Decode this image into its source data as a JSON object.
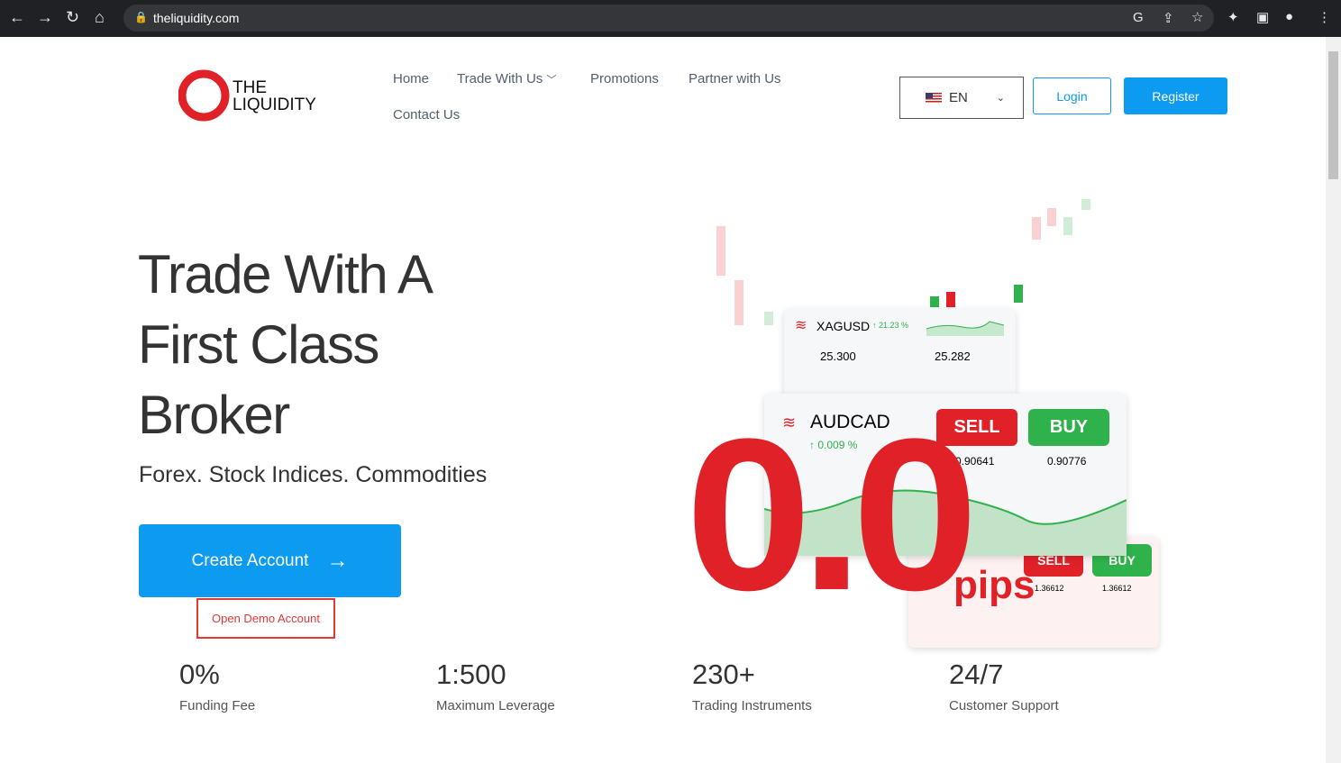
{
  "browser": {
    "url": "theliquidity.com"
  },
  "logo": {
    "text": "THE LIQUIDITY"
  },
  "nav": {
    "items": [
      "Home",
      "Trade With Us",
      "Promotions",
      "Partner with Us",
      "Contact Us"
    ]
  },
  "lang": {
    "value": "EN"
  },
  "auth": {
    "login": "Login",
    "register": "Register"
  },
  "hero": {
    "title_lines": [
      "Trade With A",
      "First Class",
      "Broker"
    ],
    "subtitle": "Forex. Stock  Indices. Commodities",
    "cta": "Create Account",
    "demo": "Open  Demo Account"
  },
  "promo": {
    "xag": {
      "symbol": "XAGUSD",
      "change": "21.23 %",
      "bid": "25.300",
      "ask": "25.282"
    },
    "aud": {
      "symbol": "AUDCAD",
      "change": "0.009 %",
      "sell": "SELL",
      "buy": "BUY",
      "bid": "0.90641",
      "ask": "0.90776"
    },
    "third": {
      "sell": "SELL",
      "buy": "BUY",
      "bid": "1.36612",
      "ask": "1.36612"
    },
    "big": "0.0",
    "unit": "pips"
  },
  "stats": [
    {
      "value": "0%",
      "label": "Funding  Fee"
    },
    {
      "value": "1:500",
      "label": "Maximum  Leverage"
    },
    {
      "value": "230+",
      "label": "Trading  Instruments"
    },
    {
      "value": "24/7",
      "label": "Customer  Support"
    }
  ],
  "colors": {
    "accent": "#0d9bf2",
    "red": "#e02127",
    "green": "#2fb24c"
  }
}
